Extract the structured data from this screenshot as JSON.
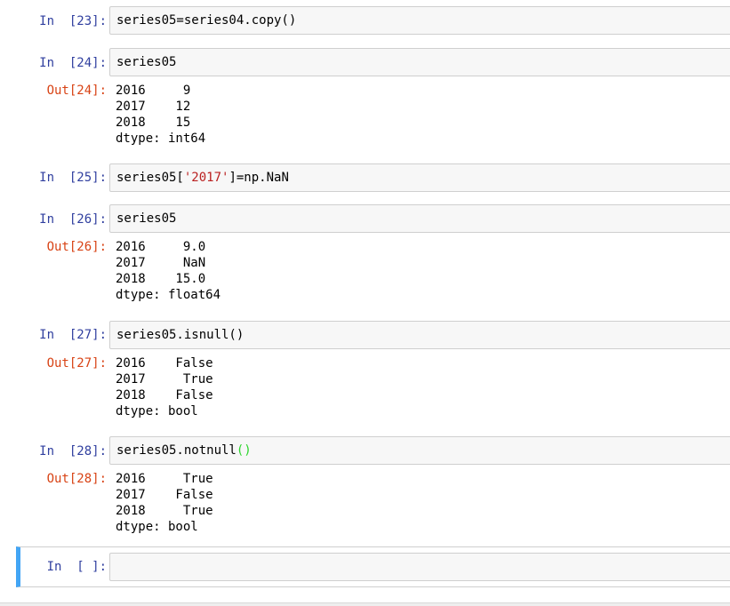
{
  "cells": [
    {
      "in_prompt": "In  [23]:",
      "code": "series05=series04.copy()"
    },
    {
      "in_prompt": "In  [24]:",
      "code": "series05",
      "out_prompt": "Out[24]:",
      "output": "2016     9\n2017    12\n2018    15\ndtype: int64"
    },
    {
      "in_prompt": "In  [25]:",
      "code_parts": [
        "series05[",
        "'2017'",
        "]=np.NaN"
      ]
    },
    {
      "in_prompt": "In  [26]:",
      "code": "series05",
      "out_prompt": "Out[26]:",
      "output": "2016     9.0\n2017     NaN\n2018    15.0\ndtype: float64"
    },
    {
      "in_prompt": "In  [27]:",
      "code": "series05.isnull()",
      "out_prompt": "Out[27]:",
      "output": "2016    False\n2017     True\n2018    False\ndtype: bool"
    },
    {
      "in_prompt": "In  [28]:",
      "code_parts": [
        "series05.notnull",
        "()"
      ],
      "out_prompt": "Out[28]:",
      "output": "2016     True\n2017    False\n2018     True\ndtype: bool"
    },
    {
      "in_prompt": "In  [ ]:",
      "code": ""
    }
  ],
  "colors": {
    "in_prompt": "#303f9f",
    "out_prompt": "#d84315",
    "string_literal": "#ba2121",
    "matching_bracket": "#2bd52b",
    "selected_cell_border": "#42a5f5",
    "input_background": "#f7f7f7"
  }
}
